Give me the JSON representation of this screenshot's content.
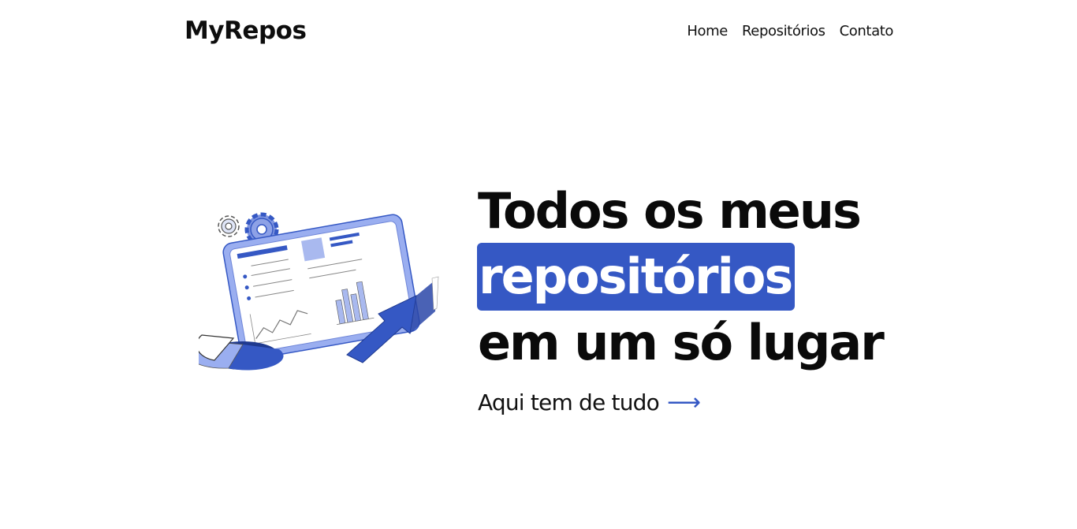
{
  "header": {
    "logo": "MyRepos",
    "nav": [
      {
        "label": "Home"
      },
      {
        "label": "Repositórios"
      },
      {
        "label": "Contato"
      }
    ]
  },
  "hero": {
    "headline_line1": "Todos os meus",
    "headline_highlight": "repositórios",
    "headline_line3": "em um só lugar",
    "cta_label": "Aqui tem de tudo",
    "cta_arrow": "⟶",
    "illustration_icon": "dashboard-analytics-illustration"
  },
  "colors": {
    "accent": "#3558c4",
    "accent_light": "#9aaef0",
    "text": "#0a0a0a",
    "background": "#ffffff"
  }
}
